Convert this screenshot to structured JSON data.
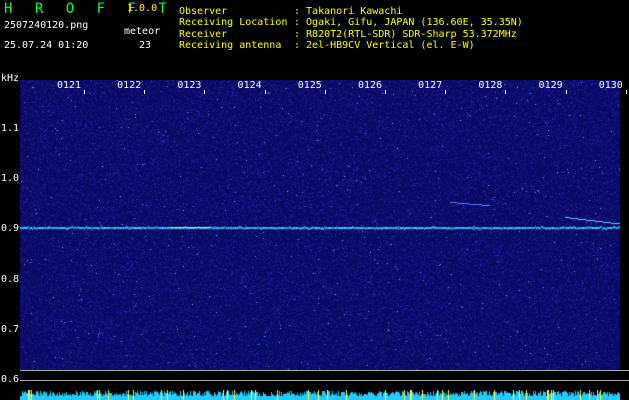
{
  "app": {
    "name": "H R O F F T",
    "version": "1.0.0"
  },
  "file": {
    "name": "2507240120.png",
    "datetime": "25.07.24 01:20"
  },
  "meteor": {
    "label": "meteor",
    "count": "23"
  },
  "info": {
    "observer_label": "Observer",
    "observer_value": ": Takanori Kawachi",
    "location_label": "Receiving Location",
    "location_value": ": Ogaki, Gifu, JAPAN (136.60E, 35.35N)",
    "receiver_label": "Receiver",
    "receiver_value": ": R820T2(RTL-SDR) SDR-Sharp 53.372MHz",
    "antenna_label": "Receiving antenna",
    "antenna_value": ": 2el-HB9CV Vertical (el. E-W)"
  },
  "axis": {
    "unit": "kHz",
    "time_ticks": [
      "0121",
      "0122",
      "0123",
      "0124",
      "0125",
      "0126",
      "0127",
      "0128",
      "0129",
      "0130"
    ],
    "freq_ticks": [
      "1.1",
      "1.0",
      "0.9",
      "0.8",
      "0.7",
      "0.6"
    ]
  },
  "colors": {
    "background": "#000000",
    "plot": "#0a0a66",
    "title": "#00ff33",
    "accent": "#ffff00",
    "trace": "#33ddff"
  }
}
